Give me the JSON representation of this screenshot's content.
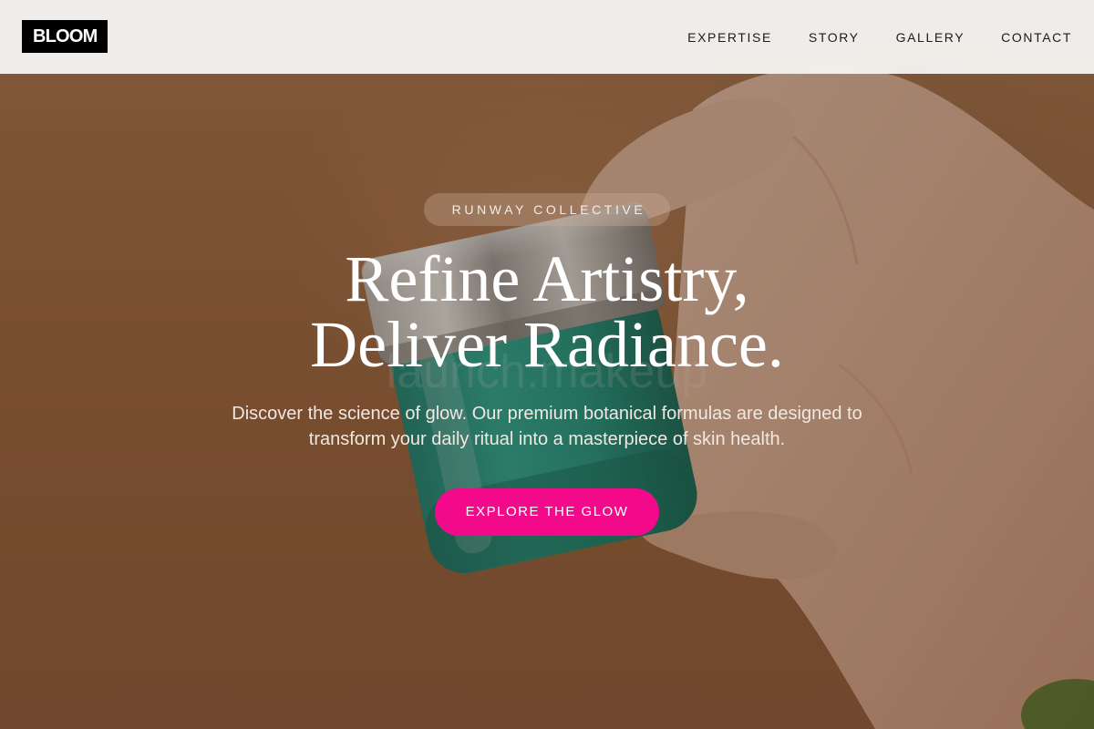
{
  "brand": {
    "logo_text": "BLOOM"
  },
  "nav": {
    "items": [
      {
        "label": "EXPERTISE"
      },
      {
        "label": "STORY"
      },
      {
        "label": "GALLERY"
      },
      {
        "label": "CONTACT"
      }
    ]
  },
  "hero": {
    "tagline": "RUNWAY COLLECTIVE",
    "headline_line1": "Refine Artistry,",
    "headline_line2": "Deliver Radiance.",
    "description": "Discover the science of glow. Our premium botanical formulas are designed to transform your daily ritual into a masterpiece of skin health.",
    "cta_label": "EXPLORE THE GLOW",
    "image_subject": "hand holding teal skincare jar with silver lid",
    "jar_label_text": "launch.makeup"
  },
  "colors": {
    "accent": "#f20a8a",
    "header_bg": "#f4f1ee",
    "logo_bg": "#000000",
    "hero_bg": "#a86f47",
    "jar_teal": "#1f9a86"
  }
}
